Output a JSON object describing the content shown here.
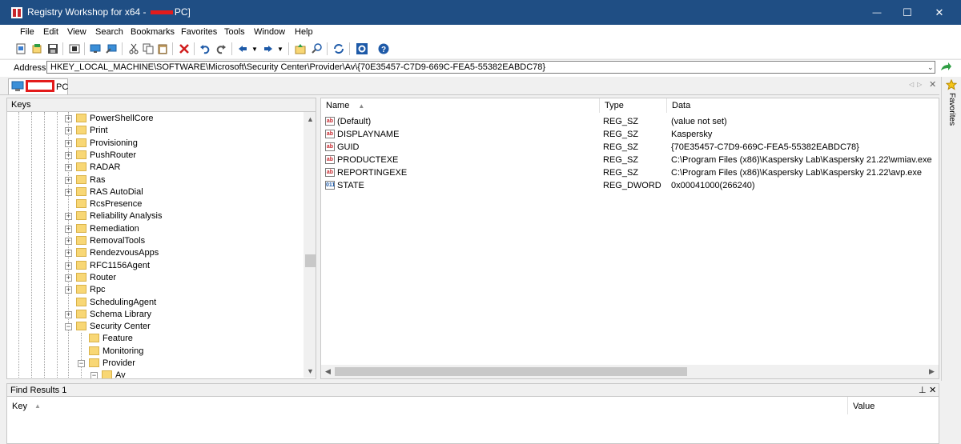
{
  "window": {
    "title_prefix": "Registry Workshop for x64 -",
    "title_suffix": "PC]",
    "minimize": "—",
    "maximize": "☐",
    "close": "✕"
  },
  "menu": [
    "File",
    "Edit",
    "View",
    "Search",
    "Bookmarks",
    "Favorites",
    "Tools",
    "Window",
    "Help"
  ],
  "address": {
    "label": "Address",
    "value": "HKEY_LOCAL_MACHINE\\SOFTWARE\\Microsoft\\Security Center\\Provider\\Av\\{70E35457-C7D9-669C-FEA5-55382EABDC78}"
  },
  "tab": {
    "label": "PC"
  },
  "favorites_label": "Favorites",
  "keys_pane": {
    "header": "Keys",
    "items": [
      {
        "label": "PowerShellCore",
        "expand": "+"
      },
      {
        "label": "Print",
        "expand": "+"
      },
      {
        "label": "Provisioning",
        "expand": "+"
      },
      {
        "label": "PushRouter",
        "expand": "+"
      },
      {
        "label": "RADAR",
        "expand": "+"
      },
      {
        "label": "Ras",
        "expand": "+"
      },
      {
        "label": "RAS AutoDial",
        "expand": "+"
      },
      {
        "label": "RcsPresence",
        "expand": ""
      },
      {
        "label": "Reliability Analysis",
        "expand": "+"
      },
      {
        "label": "Remediation",
        "expand": "+"
      },
      {
        "label": "RemovalTools",
        "expand": "+"
      },
      {
        "label": "RendezvousApps",
        "expand": "+"
      },
      {
        "label": "RFC1156Agent",
        "expand": "+"
      },
      {
        "label": "Router",
        "expand": "+"
      },
      {
        "label": "Rpc",
        "expand": "+"
      },
      {
        "label": "SchedulingAgent",
        "expand": ""
      },
      {
        "label": "Schema Library",
        "expand": "+"
      },
      {
        "label": "Security Center",
        "expand": "−"
      }
    ],
    "children": [
      {
        "label": "Feature"
      },
      {
        "label": "Monitoring"
      },
      {
        "label": "Provider",
        "expand": "−"
      }
    ],
    "grandchild": {
      "label": "Av",
      "expand": "−"
    }
  },
  "values_pane": {
    "columns": {
      "name": "Name",
      "type": "Type",
      "data": "Data"
    },
    "rows": [
      {
        "name": "(Default)",
        "type": "REG_SZ",
        "data": "(value not set)",
        "icon": "ab"
      },
      {
        "name": "DISPLAYNAME",
        "type": "REG_SZ",
        "data": "Kaspersky",
        "icon": "ab"
      },
      {
        "name": "GUID",
        "type": "REG_SZ",
        "data": "{70E35457-C7D9-669C-FEA5-55382EABDC78}",
        "icon": "ab"
      },
      {
        "name": "PRODUCTEXE",
        "type": "REG_SZ",
        "data": "C:\\Program Files (x86)\\Kaspersky Lab\\Kaspersky 21.22\\wmiav.exe",
        "icon": "ab"
      },
      {
        "name": "REPORTINGEXE",
        "type": "REG_SZ",
        "data": "C:\\Program Files (x86)\\Kaspersky Lab\\Kaspersky 21.22\\avp.exe",
        "icon": "ab"
      },
      {
        "name": "STATE",
        "type": "REG_DWORD",
        "data": "0x00041000(266240)",
        "icon": "011"
      }
    ]
  },
  "find_results": {
    "title": "Find Results 1",
    "pin": "⊥",
    "close": "✕",
    "columns": {
      "key": "Key",
      "value": "Value"
    }
  },
  "colors": {
    "titlebar": "#1f4e84",
    "redaction": "#e31b1b",
    "folder": "#f8d775"
  }
}
